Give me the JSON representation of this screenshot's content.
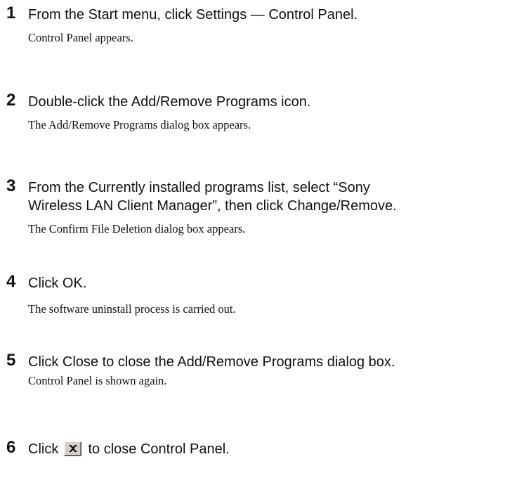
{
  "steps": [
    {
      "number": "1",
      "instruction": "From the Start menu, click Settings — Control Panel.",
      "result": "Control Panel appears."
    },
    {
      "number": "2",
      "instruction": "Double-click the Add/Remove Programs icon.",
      "result": "The Add/Remove Programs dialog box appears."
    },
    {
      "number": "3",
      "instruction_line1": "From the Currently installed programs list, select “Sony",
      "instruction_line2": "Wireless LAN Client Manager”, then click Change/Remove.",
      "result": "The Confirm File Deletion dialog box appears."
    },
    {
      "number": "4",
      "instruction": "Click OK.",
      "result": "The software uninstall process is carried out."
    },
    {
      "number": "5",
      "instruction": "Click Close to close the Add/Remove Programs dialog box.",
      "result": "Control Panel is shown again."
    },
    {
      "number": "6",
      "instruction_before_icon": "Click",
      "icon": "close-window-x-icon",
      "instruction_after_icon": "to close Control Panel."
    }
  ]
}
